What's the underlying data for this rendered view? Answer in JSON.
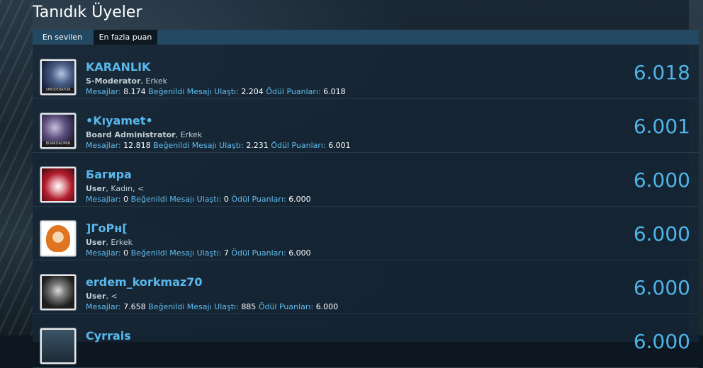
{
  "title": "Tanıdık Üyeler",
  "tabs": [
    {
      "label": "En sevilen"
    },
    {
      "label": "En fazla puan"
    }
  ],
  "labels": {
    "messages": "Mesajlar:",
    "likes": "Beğenildi Mesajı Ulaştı:",
    "points": "Ödül Puanları:"
  },
  "members": [
    {
      "name": "KARANLIK",
      "role": "S-Moderator",
      "extra": ", Erkek",
      "messages": "8.174",
      "likes": "2.204",
      "points": "6.018",
      "score": "6.018",
      "avatar_badge": "SMODERATOR"
    },
    {
      "name": "•Kıyamet•",
      "role": "Board Administrator",
      "extra": ", Erkek",
      "messages": "12.818",
      "likes": "2.231",
      "points": "6.001",
      "score": "6.001",
      "avatar_badge": "BOARDADMIN"
    },
    {
      "name": "Багира",
      "role": "User",
      "extra": ", Kadın, <",
      "messages": "0",
      "likes": "0",
      "points": "6.000",
      "score": "6.000"
    },
    {
      "name": "]ГоРн[",
      "role": "User",
      "extra": ", Erkek",
      "messages": "0",
      "likes": "7",
      "points": "6.000",
      "score": "6.000"
    },
    {
      "name": "erdem_korkmaz70",
      "role": "User",
      "extra": ", <",
      "messages": "7.658",
      "likes": "885",
      "points": "6.000",
      "score": "6.000"
    },
    {
      "name": "Cyrrais",
      "score": "6.000"
    }
  ]
}
